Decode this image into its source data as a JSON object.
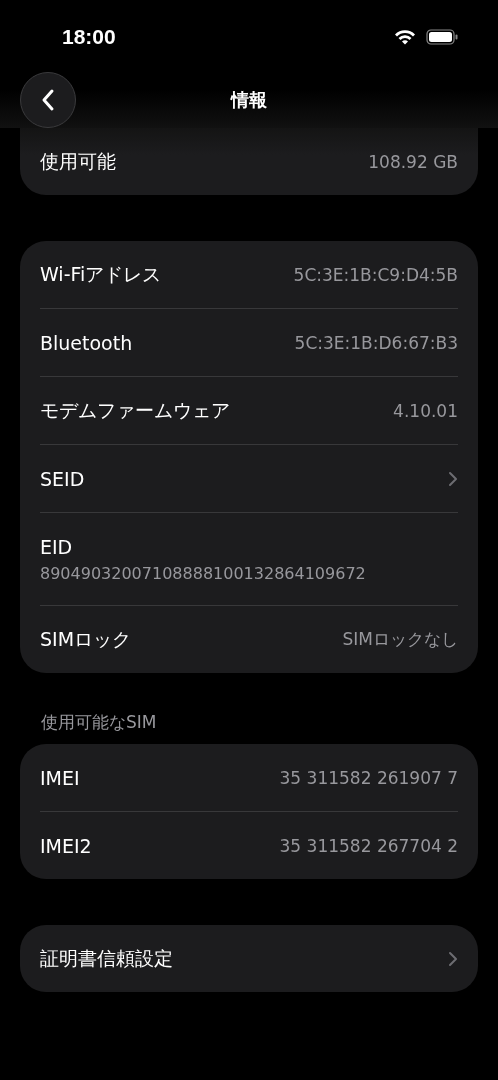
{
  "status_bar": {
    "time": "18:00"
  },
  "nav": {
    "title": "情報"
  },
  "groups": [
    {
      "rows": [
        {
          "kind": "value",
          "label": "使用可能",
          "value": "108.92 GB"
        }
      ]
    },
    {
      "rows": [
        {
          "kind": "value",
          "label": "Wi-Fiアドレス",
          "value": "5C:3E:1B:C9:D4:5B"
        },
        {
          "kind": "value",
          "label": "Bluetooth",
          "value": "5C:3E:1B:D6:67:B3"
        },
        {
          "kind": "value",
          "label": "モデムファームウェア",
          "value": "4.10.01"
        },
        {
          "kind": "chevron",
          "label": "SEID"
        },
        {
          "kind": "stacked",
          "label": "EID",
          "value": "89049032007108888100132864109672"
        },
        {
          "kind": "value",
          "label": "SIMロック",
          "value": "SIMロックなし"
        }
      ]
    },
    {
      "header": "使用可能なSIM",
      "rows": [
        {
          "kind": "value",
          "label": "IMEI",
          "value": "35 311582 261907 7"
        },
        {
          "kind": "value",
          "label": "IMEI2",
          "value": "35 311582 267704 2"
        }
      ]
    },
    {
      "rows": [
        {
          "kind": "chevron",
          "label": "証明書信頼設定"
        }
      ]
    }
  ]
}
